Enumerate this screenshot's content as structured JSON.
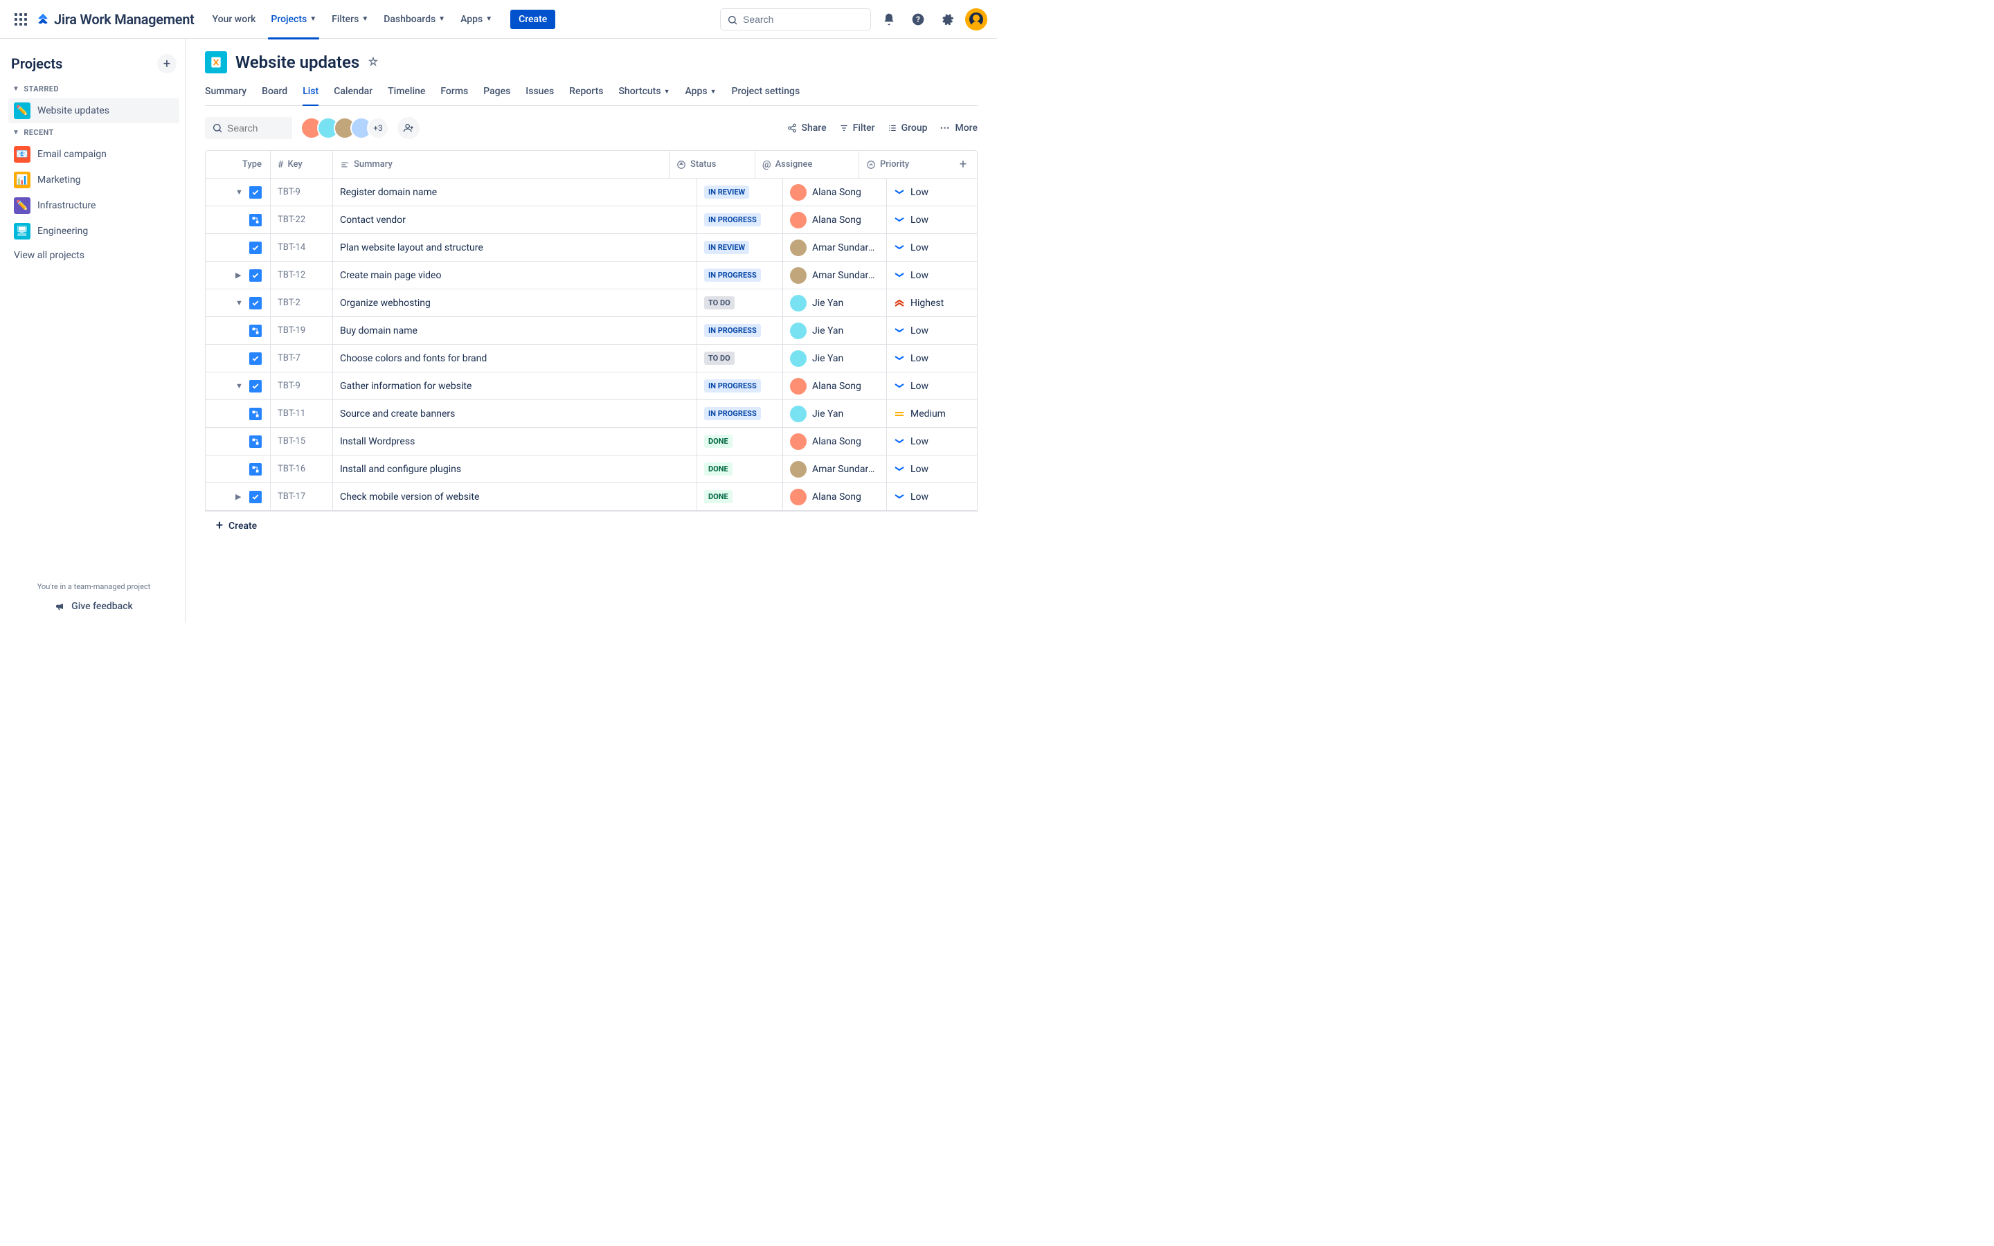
{
  "topnav": {
    "product": "Jira Work Management",
    "items": [
      "Your work",
      "Projects",
      "Filters",
      "Dashboards",
      "Apps"
    ],
    "active": "Projects",
    "create": "Create",
    "search_placeholder": "Search"
  },
  "sidebar": {
    "heading": "Projects",
    "sections": [
      {
        "label": "STARRED",
        "items": [
          {
            "name": "Website updates",
            "color": "#00B8D9",
            "icon": "✏️",
            "selected": true
          }
        ]
      },
      {
        "label": "RECENT",
        "items": [
          {
            "name": "Email campaign",
            "color": "#FF5630",
            "icon": "📧"
          },
          {
            "name": "Marketing",
            "color": "#FFAB00",
            "icon": "📊"
          },
          {
            "name": "Infrastructure",
            "color": "#6554C0",
            "icon": "✏️"
          },
          {
            "name": "Engineering",
            "color": "#00B8D9",
            "icon": "🖥"
          }
        ]
      }
    ],
    "view_all": "View all projects",
    "team_msg": "You're in a team-managed project",
    "feedback": "Give feedback"
  },
  "project": {
    "title": "Website updates",
    "tabs": [
      "Summary",
      "Board",
      "List",
      "Calendar",
      "Timeline",
      "Forms",
      "Pages",
      "Issues",
      "Reports",
      "Shortcuts",
      "Apps",
      "Project settings"
    ],
    "active_tab": "List",
    "dropdown_tabs": [
      "Shortcuts",
      "Apps"
    ]
  },
  "toolbar": {
    "search_placeholder": "Search",
    "more_count": "+3",
    "actions": {
      "share": "Share",
      "filter": "Filter",
      "group": "Group",
      "more": "More"
    }
  },
  "table": {
    "headers": {
      "type": "Type",
      "key": "Key",
      "summary": "Summary",
      "status": "Status",
      "assignee": "Assignee",
      "priority": "Priority"
    },
    "rows": [
      {
        "expand": "down",
        "type": "task",
        "key": "TBT-9",
        "summary": "Register domain name",
        "status": "IN REVIEW",
        "status_cls": "review",
        "assignee": "Alana Song",
        "av": "#FF8F73",
        "priority": "Low",
        "pri_cls": "low"
      },
      {
        "indent": true,
        "type": "sub",
        "key": "TBT-22",
        "summary": "Contact vendor",
        "status": "IN PROGRESS",
        "status_cls": "progress",
        "assignee": "Alana Song",
        "av": "#FF8F73",
        "priority": "Low",
        "pri_cls": "low"
      },
      {
        "type": "task",
        "key": "TBT-14",
        "summary": "Plan website layout and structure",
        "status": "IN REVIEW",
        "status_cls": "review",
        "assignee": "Amar Sundaram",
        "av": "#C1A57B",
        "priority": "Low",
        "pri_cls": "low"
      },
      {
        "expand": "right",
        "type": "task",
        "key": "TBT-12",
        "summary": "Create main page video",
        "status": "IN PROGRESS",
        "status_cls": "progress",
        "assignee": "Amar Sundaram",
        "av": "#C1A57B",
        "priority": "Low",
        "pri_cls": "low"
      },
      {
        "expand": "down",
        "type": "task",
        "key": "TBT-2",
        "summary": "Organize webhosting",
        "status": "TO DO",
        "status_cls": "todo",
        "assignee": "Jie Yan",
        "av": "#79E2F2",
        "priority": "Highest",
        "pri_cls": "highest"
      },
      {
        "indent": true,
        "type": "sub",
        "key": "TBT-19",
        "summary": "Buy domain name",
        "status": "IN PROGRESS",
        "status_cls": "progress",
        "assignee": "Jie Yan",
        "av": "#79E2F2",
        "priority": "Low",
        "pri_cls": "low"
      },
      {
        "type": "task",
        "key": "TBT-7",
        "summary": "Choose colors and fonts for brand",
        "status": "TO DO",
        "status_cls": "todo",
        "assignee": "Jie Yan",
        "av": "#79E2F2",
        "priority": "Low",
        "pri_cls": "low"
      },
      {
        "expand": "down",
        "type": "task",
        "key": "TBT-9",
        "summary": "Gather information for website",
        "status": "IN PROGRESS",
        "status_cls": "progress",
        "assignee": "Alana Song",
        "av": "#FF8F73",
        "priority": "Low",
        "pri_cls": "low"
      },
      {
        "indent": true,
        "type": "sub",
        "key": "TBT-11",
        "summary": "Source and create banners",
        "status": "IN PROGRESS",
        "status_cls": "progress",
        "assignee": "Jie Yan",
        "av": "#79E2F2",
        "priority": "Medium",
        "pri_cls": "medium"
      },
      {
        "indent": true,
        "type": "sub",
        "key": "TBT-15",
        "summary": "Install Wordpress",
        "status": "DONE",
        "status_cls": "done",
        "assignee": "Alana Song",
        "av": "#FF8F73",
        "priority": "Low",
        "pri_cls": "low"
      },
      {
        "indent": true,
        "type": "sub",
        "key": "TBT-16",
        "summary": "Install and configure plugins",
        "status": "DONE",
        "status_cls": "done",
        "assignee": "Amar Sundaram",
        "av": "#C1A57B",
        "priority": "Low",
        "pri_cls": "low"
      },
      {
        "expand": "right",
        "type": "task",
        "key": "TBT-17",
        "summary": "Check mobile version of website",
        "status": "DONE",
        "status_cls": "done",
        "assignee": "Alana Song",
        "av": "#FF8F73",
        "priority": "Low",
        "pri_cls": "low"
      }
    ],
    "create": "Create"
  }
}
